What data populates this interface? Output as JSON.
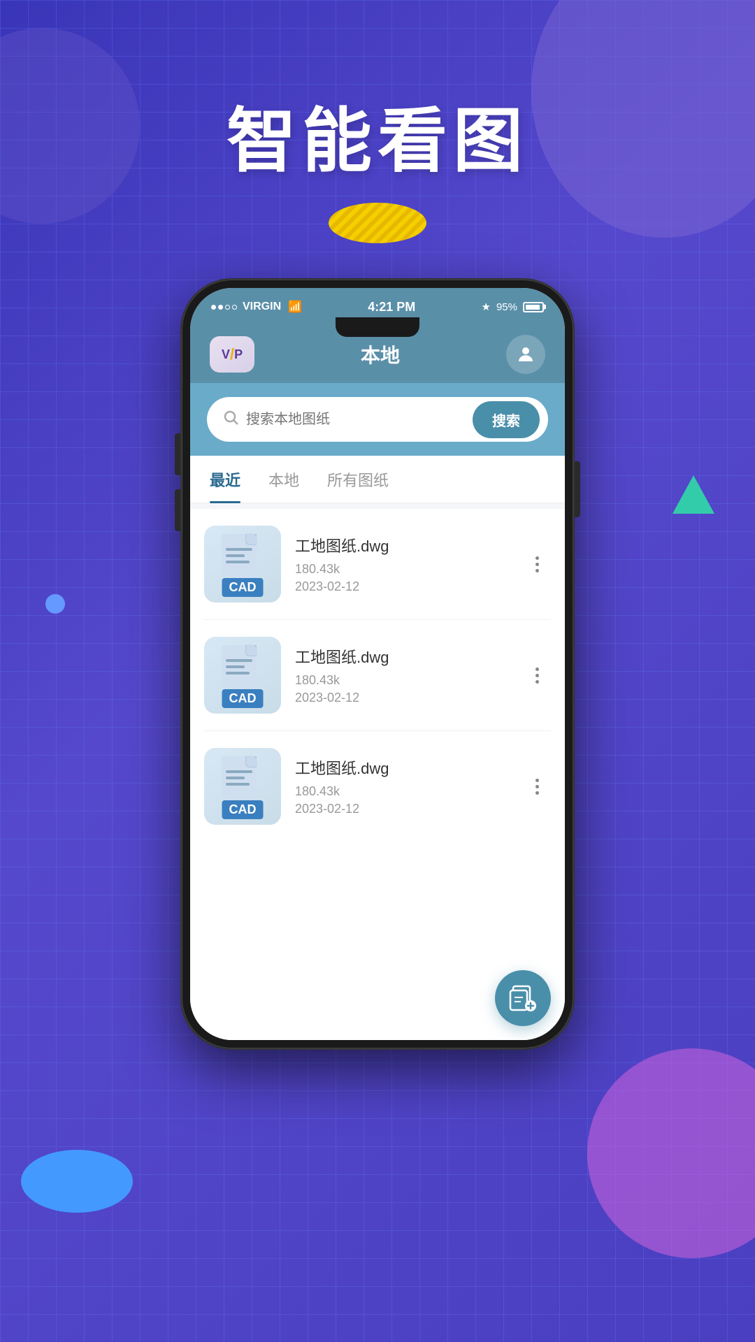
{
  "background": {
    "gradient_start": "#3a35b8",
    "gradient_end": "#5548cc"
  },
  "title": {
    "main": "智能看图"
  },
  "status_bar": {
    "carrier": "VIRGIN",
    "time": "4:21 PM",
    "bluetooth": "B",
    "battery_percent": "95%"
  },
  "app_header": {
    "vip_label": "VIP",
    "title": "本地",
    "user_icon": "user"
  },
  "search": {
    "placeholder": "搜索本地图纸",
    "button_label": "搜索"
  },
  "tabs": [
    {
      "label": "最近",
      "active": true
    },
    {
      "label": "本地",
      "active": false
    },
    {
      "label": "所有图纸",
      "active": false
    }
  ],
  "files": [
    {
      "name": "工地图纸.dwg",
      "size": "180.43k",
      "date": "2023-02-12",
      "badge": "CAD"
    },
    {
      "name": "工地图纸.dwg",
      "size": "180.43k",
      "date": "2023-02-12",
      "badge": "CAD"
    },
    {
      "name": "工地图纸.dwg",
      "size": "180.43k",
      "date": "2023-02-12",
      "badge": "CAD"
    }
  ],
  "fab": {
    "label": "添加文件"
  }
}
